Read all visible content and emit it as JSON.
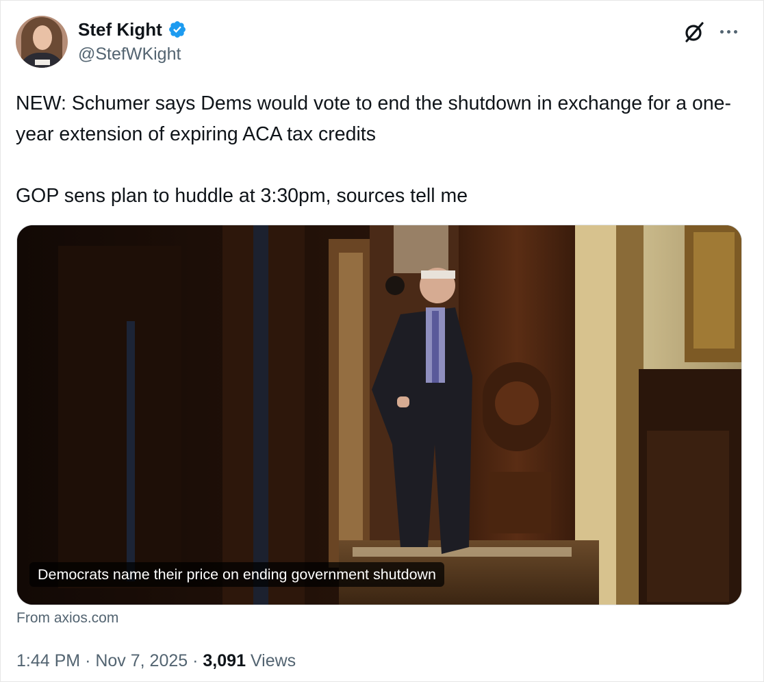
{
  "author": {
    "name": "Stef Kight",
    "handle": "@StefWKight",
    "verified": true,
    "avatar_icon": "profile-photo-woman",
    "verified_color": "#1d9bf0"
  },
  "header_icons": [
    "grok-icon",
    "more-options-icon"
  ],
  "tweet": {
    "text_line1": "NEW: Schumer says Dems would vote to end the shutdown in exchange for a one-year extension of expiring ACA tax credits",
    "text_line2": "GOP sens plan to huddle at 3:30pm, sources tell me"
  },
  "link_card": {
    "caption": "Democrats name their price on ending government shutdown",
    "source": "From axios.com"
  },
  "meta": {
    "time": "1:44 PM",
    "separator": "·",
    "date": "Nov 7, 2025",
    "views_count": "3,091",
    "views_label": "Views"
  },
  "colors": {
    "text": "#0f1419",
    "secondary": "#536471",
    "accent": "#1d9bf0"
  }
}
